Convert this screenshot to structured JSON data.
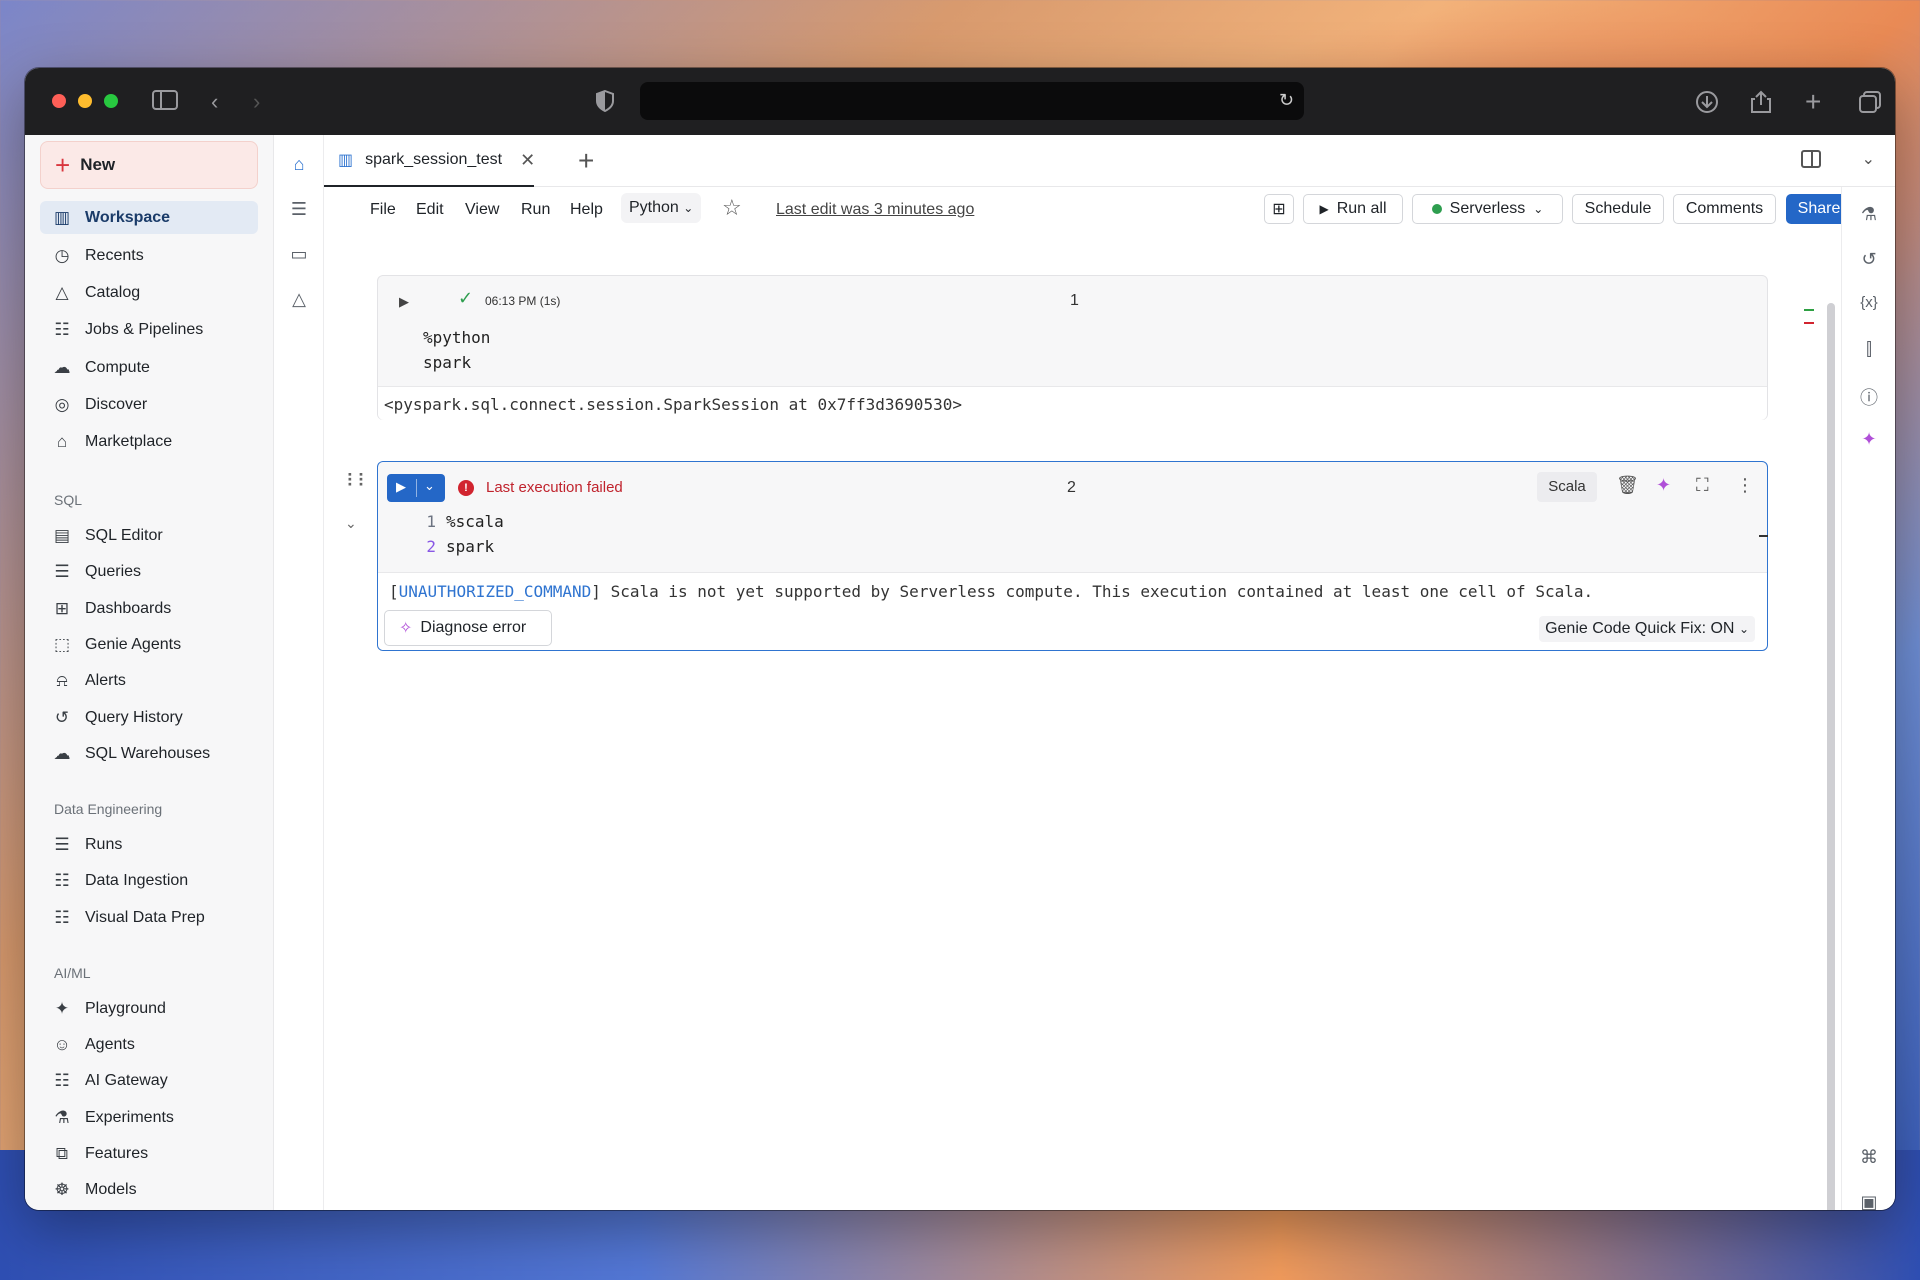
{
  "browser": {
    "url": ""
  },
  "sidebar": {
    "new_label": "New",
    "items": [
      {
        "label": "Workspace",
        "icon": "workspace-icon",
        "active": true
      },
      {
        "label": "Recents",
        "icon": "clock-icon"
      },
      {
        "label": "Catalog",
        "icon": "catalog-icon"
      },
      {
        "label": "Jobs & Pipelines",
        "icon": "jobs-icon"
      },
      {
        "label": "Compute",
        "icon": "cloud-icon"
      },
      {
        "label": "Discover",
        "icon": "compass-icon"
      },
      {
        "label": "Marketplace",
        "icon": "store-icon"
      }
    ],
    "sql_section": "SQL",
    "sql_items": [
      {
        "label": "SQL Editor",
        "icon": "sql-editor-icon"
      },
      {
        "label": "Queries",
        "icon": "queries-icon"
      },
      {
        "label": "Dashboards",
        "icon": "dashboard-icon"
      },
      {
        "label": "Genie Agents",
        "icon": "genie-icon"
      },
      {
        "label": "Alerts",
        "icon": "bell-icon"
      },
      {
        "label": "Query History",
        "icon": "history-icon"
      },
      {
        "label": "SQL Warehouses",
        "icon": "warehouse-icon"
      }
    ],
    "de_section": "Data Engineering",
    "de_items": [
      {
        "label": "Runs",
        "icon": "runs-icon"
      },
      {
        "label": "Data Ingestion",
        "icon": "ingestion-icon"
      },
      {
        "label": "Visual Data Prep",
        "icon": "dataprep-icon"
      }
    ],
    "ai_section": "AI/ML",
    "ai_items": [
      {
        "label": "Playground",
        "icon": "sparkle-icon"
      },
      {
        "label": "Agents",
        "icon": "agents-icon"
      },
      {
        "label": "AI Gateway",
        "icon": "gateway-icon"
      },
      {
        "label": "Experiments",
        "icon": "flask-icon"
      },
      {
        "label": "Features",
        "icon": "features-icon"
      },
      {
        "label": "Models",
        "icon": "models-icon"
      }
    ]
  },
  "tab": {
    "title": "spark_session_test"
  },
  "toolbar": {
    "menu": [
      "File",
      "Edit",
      "View",
      "Run",
      "Help"
    ],
    "language": "Python",
    "last_edit": "Last edit was 3 minutes ago",
    "run_all": "Run all",
    "compute": "Serverless",
    "schedule": "Schedule",
    "comments": "Comments",
    "share": "Share"
  },
  "cells": [
    {
      "number": "1",
      "exec_time": "06:13 PM (1s)",
      "code": [
        "%python",
        "spark"
      ],
      "output": "<pyspark.sql.connect.session.SparkSession at 0x7ff3d3690530>"
    },
    {
      "number": "2",
      "status": "Last execution failed",
      "language": "Scala",
      "line_numbers": [
        "1",
        "2"
      ],
      "code": [
        "%scala",
        "spark"
      ],
      "error_code": "UNAUTHORIZED_COMMAND",
      "error_message": "Scala is not yet supported by Serverless compute. This execution contained at least one cell of Scala.",
      "diagnose": "Diagnose error",
      "quick_fix": "Genie Code Quick Fix: ON"
    }
  ],
  "colors": {
    "accent": "#2467c7",
    "error": "#c0232d",
    "success": "#2e9e4f"
  }
}
